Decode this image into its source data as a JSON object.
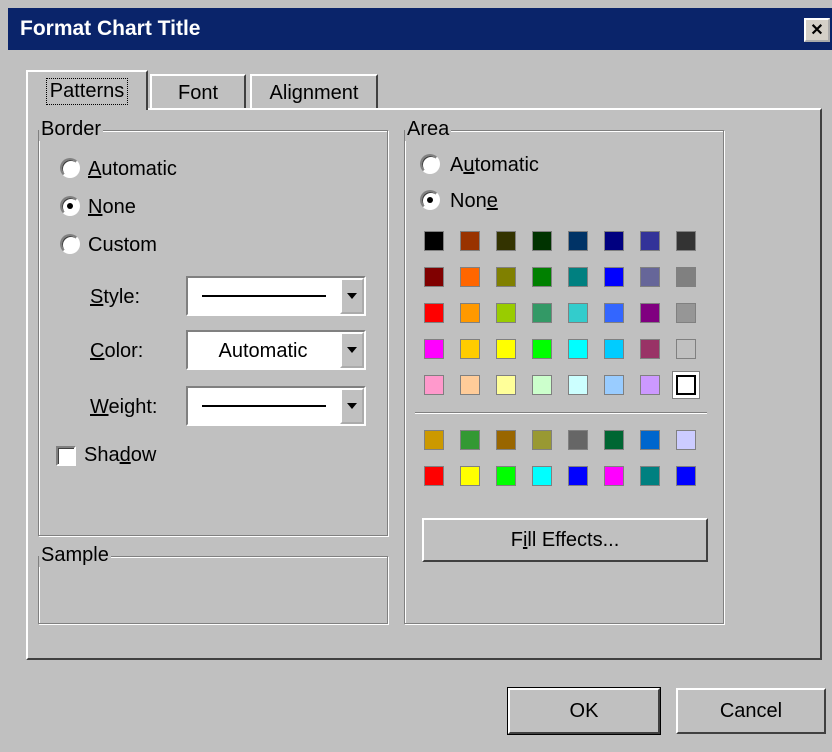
{
  "window": {
    "title": "Format Chart Title",
    "close_glyph": "✕"
  },
  "tabs": [
    {
      "label": "Patterns",
      "active": true
    },
    {
      "label": "Font",
      "active": false
    },
    {
      "label": "Alignment",
      "active": false
    }
  ],
  "border": {
    "legend": "Border",
    "options": [
      {
        "label": "Automatic",
        "checked": false
      },
      {
        "label": "None",
        "checked": true
      },
      {
        "label": "Custom",
        "checked": false
      }
    ],
    "style_label": "Style:",
    "color_label": "Color:",
    "color_value": "Automatic",
    "weight_label": "Weight:",
    "shadow_label": "Shadow",
    "shadow_checked": false
  },
  "sample": {
    "legend": "Sample"
  },
  "area": {
    "legend": "Area",
    "options": [
      {
        "label": "Automatic",
        "checked": false
      },
      {
        "label": "None",
        "checked": true
      }
    ],
    "palette_main": [
      [
        "#000000",
        "#993300",
        "#333300",
        "#003300",
        "#003366",
        "#000080",
        "#333399",
        "#333333"
      ],
      [
        "#800000",
        "#FF6600",
        "#808000",
        "#008000",
        "#008080",
        "#0000FF",
        "#666699",
        "#808080"
      ],
      [
        "#FF0000",
        "#FF9900",
        "#99CC00",
        "#339966",
        "#33CCCC",
        "#3366FF",
        "#800080",
        "#969696"
      ],
      [
        "#FF00FF",
        "#FFCC00",
        "#FFFF00",
        "#00FF00",
        "#00FFFF",
        "#00CCFF",
        "#993366",
        "#C0C0C0"
      ],
      [
        "#FF99CC",
        "#FFCC99",
        "#FFFF99",
        "#CCFFCC",
        "#CCFFFF",
        "#99CCFF",
        "#CC99FF",
        "#FFFFFF"
      ]
    ],
    "palette_chart": [
      [
        "#CC9900",
        "#339933",
        "#996600",
        "#999933",
        "#666666",
        "#006633",
        "#0066CC",
        "#CCCCFF"
      ],
      [
        "#FF0000",
        "#FFFF00",
        "#00FF00",
        "#00FFFF",
        "#0000FF",
        "#FF00FF",
        "#008080",
        "#0000FF"
      ]
    ],
    "selected_color": "#FFFFFF",
    "fill_effects_label": "Fill Effects..."
  },
  "buttons": {
    "ok": "OK",
    "cancel": "Cancel"
  }
}
